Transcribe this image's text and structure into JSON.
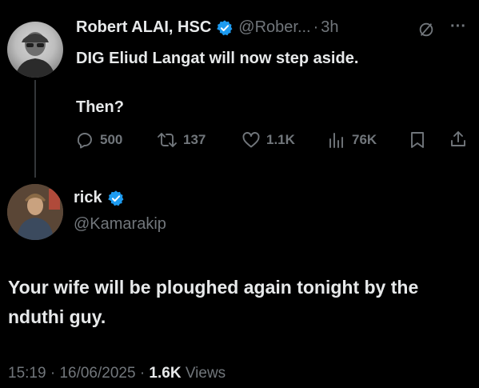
{
  "parent": {
    "display_name": "Robert ALAI, HSC",
    "handle": "@Rober...",
    "dot": "·",
    "age": "3h",
    "more": "···",
    "text_line1": "DIG Eliud Langat will now step aside.",
    "text_line2": "Then?",
    "stats": {
      "replies": "500",
      "reposts": "137",
      "likes": "1.1K",
      "views": "76K"
    }
  },
  "reply": {
    "display_name": "rick",
    "handle": "@Kamarakip",
    "body": "Your wife will be ploughed again tonight by the nduthi guy.",
    "time": "15:19",
    "sep1": "·",
    "date": "16/06/2025",
    "sep2": "·",
    "views_count": "1.6K",
    "views_label": "Views"
  },
  "colors": {
    "background": "#000000",
    "text": "#e7e9ea",
    "muted": "#71767b",
    "verified": "#1d9bf0"
  },
  "icons": {
    "reply": "comment-icon",
    "repost": "repost-icon",
    "like": "heart-icon",
    "views": "bar-chart-icon",
    "bookmark": "bookmark-icon",
    "share": "share-icon",
    "grok": "slashed-circle-icon",
    "more": "more-icon",
    "verified": "verified-badge-icon"
  }
}
